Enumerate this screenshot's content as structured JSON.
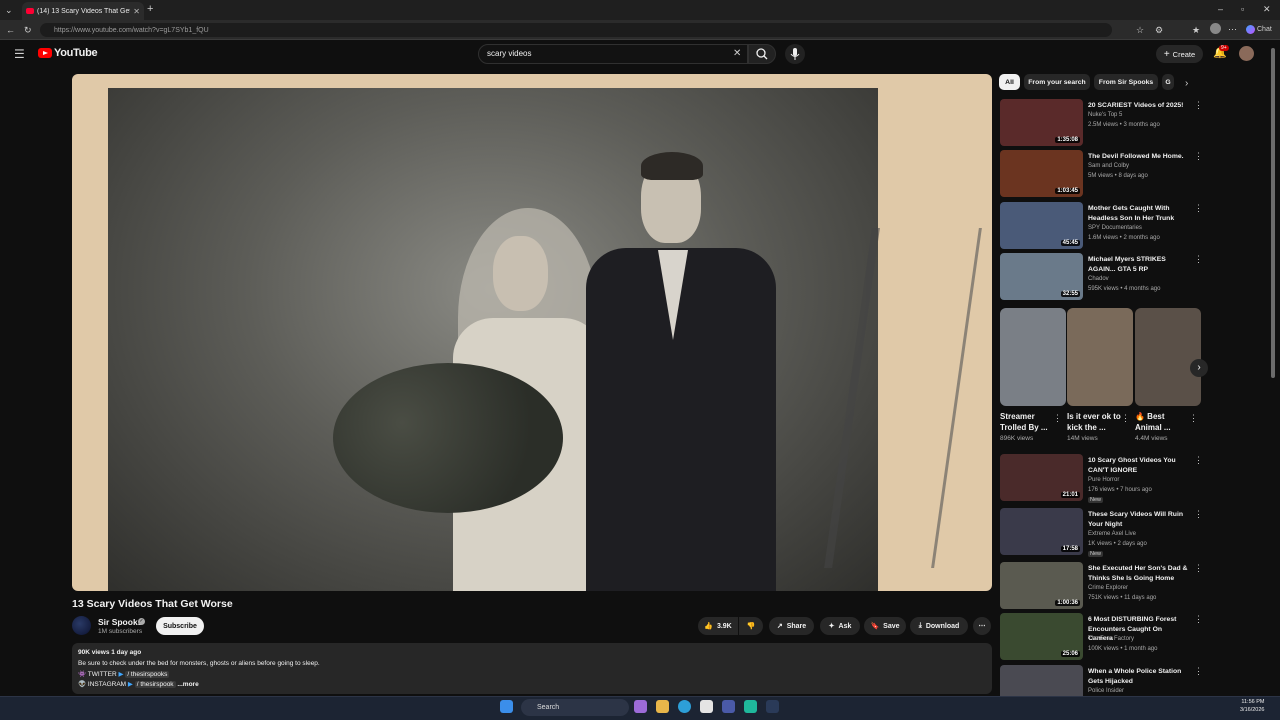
{
  "browser": {
    "tab_title": "(14) 13 Scary Videos That Get W",
    "url": "https://www.youtube.com/watch?v=gL7SYb1_fQU",
    "chat_label": "Chat"
  },
  "header": {
    "logo_text": "YouTube",
    "search_value": "scary videos",
    "create_label": "Create",
    "notif_count": "9+"
  },
  "video": {
    "title": "13 Scary Videos That Get Worse",
    "channel": "Sir Spooks",
    "subscribers": "1M subscribers",
    "subscribe_label": "Subscribe",
    "likes": "3.9K",
    "share_label": "Share",
    "ask_label": "Ask",
    "save_label": "Save",
    "download_label": "Download",
    "desc_stats": "90K views  1 day ago",
    "desc_line": "Be sure to check under the bed for monsters, ghosts or aliens before going to sleep.",
    "twitter_label": "TWITTER",
    "twitter_handle": "/ thesirspooks",
    "instagram_label": "INSTAGRAM",
    "instagram_handle": "/ thesirspook",
    "more_label": "...more"
  },
  "chips": [
    "All",
    "From your search",
    "From Sir Spooks",
    "G"
  ],
  "recommendations": [
    {
      "title": "20 SCARIEST Videos of 2025!",
      "channel": "Nuke's Top 5",
      "meta": "2.5M views • 3 months ago",
      "duration": "1:35:08",
      "color": "#5a2a2a"
    },
    {
      "title": "The Devil Followed Me Home.",
      "channel": "Sam and Colby",
      "meta": "5M views • 8 days ago",
      "duration": "1:03:45",
      "color": "#6b3420"
    },
    {
      "title": "Mother Gets Caught With Headless Son In Her Trunk",
      "channel": "SPY Documentaries",
      "meta": "1.6M views • 2 months ago",
      "duration": "45:45",
      "color": "#4a5a78"
    },
    {
      "title": "Michael Myers STRIKES AGAIN... GTA 5 RP",
      "channel": "Chadov",
      "meta": "595K views • 4 months ago",
      "duration": "32:55",
      "color": "#6a7a8a"
    }
  ],
  "shorts": [
    {
      "title": "Streamer Trolled By ...",
      "views": "896K views",
      "color": "#7a7f86"
    },
    {
      "title": "Is it ever ok to kick the ...",
      "views": "14M views",
      "color": "#7a6a5a"
    },
    {
      "title": "🔥 Best Animal ...",
      "views": "4.4M views",
      "color": "#5a5048"
    }
  ],
  "recommendations2": [
    {
      "title": "10 Scary Ghost Videos You CAN'T IGNORE",
      "channel": "Pure Horror",
      "meta": "176 views • 7 hours ago",
      "duration": "21:01",
      "badge": "New",
      "color": "#4a2a2a"
    },
    {
      "title": "These Scary Videos Will Ruin Your Night",
      "channel": "Extreme Axel Live",
      "meta": "1K views • 2 days ago",
      "duration": "17:58",
      "badge": "New",
      "color": "#3a3a4a"
    },
    {
      "title": "She Executed Her Son's Dad & Thinks She Is Going Home",
      "channel": "Crime Explorer",
      "meta": "751K views • 11 days ago",
      "duration": "1:00:36",
      "color": "#5a5a50"
    },
    {
      "title": "6 Most DISTURBING Forest Encounters Caught On Camera",
      "channel": "The Fear Factory",
      "meta": "100K views • 1 month ago",
      "duration": "25:06",
      "color": "#3a4a30"
    },
    {
      "title": "When a Whole Police Station Gets Hijacked",
      "channel": "Police Insider",
      "meta": "",
      "duration": "",
      "color": "#4a4a52"
    }
  ],
  "taskbar": {
    "search_label": "Search",
    "time": "11:56 PM",
    "date": "3/16/2026"
  }
}
